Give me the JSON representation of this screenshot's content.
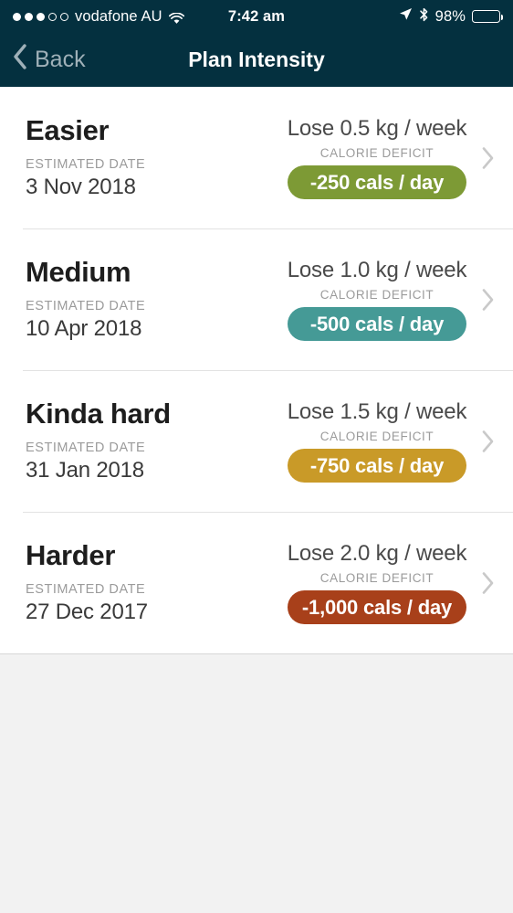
{
  "status_bar": {
    "signal_dots_total": 5,
    "signal_dots_filled": 3,
    "carrier": "vodafone AU",
    "wifi_icon": "wifi-icon",
    "time": "7:42 am",
    "location_icon": "location-arrow-icon",
    "bluetooth_icon": "bluetooth-icon",
    "battery_percent": "98%",
    "battery_level": 98
  },
  "navbar": {
    "back_label": "Back",
    "back_icon": "chevron-left-icon",
    "title": "Plan Intensity",
    "background": "#04303f",
    "title_color": "#ffffff",
    "back_color": "#9fb0b8"
  },
  "labels": {
    "estimated_date": "ESTIMATED DATE",
    "calorie_deficit": "CALORIE DEFICIT",
    "disclosure_icon": "chevron-right-icon"
  },
  "plans": [
    {
      "name": "Easier",
      "estimated_date_label": "ESTIMATED DATE",
      "estimated_date": "3 Nov 2018",
      "rate": "Lose 0.5 kg / week",
      "deficit_label": "CALORIE DEFICIT",
      "deficit": "-250 cals / day",
      "badge_color": "#7d9a35"
    },
    {
      "name": "Medium",
      "estimated_date_label": "ESTIMATED DATE",
      "estimated_date": "10 Apr 2018",
      "rate": "Lose 1.0 kg / week",
      "deficit_label": "CALORIE DEFICIT",
      "deficit": "-500 cals / day",
      "badge_color": "#459a96"
    },
    {
      "name": "Kinda hard",
      "estimated_date_label": "ESTIMATED DATE",
      "estimated_date": "31 Jan 2018",
      "rate": "Lose 1.5 kg / week",
      "deficit_label": "CALORIE DEFICIT",
      "deficit": "-750 cals / day",
      "badge_color": "#c99a28"
    },
    {
      "name": "Harder",
      "estimated_date_label": "ESTIMATED DATE",
      "estimated_date": "27 Dec 2017",
      "rate": "Lose 2.0 kg / week",
      "deficit_label": "CALORIE DEFICIT",
      "deficit": "-1,000 cals / day",
      "badge_color": "#a8401a"
    }
  ],
  "page_background": "#f2f2f2"
}
